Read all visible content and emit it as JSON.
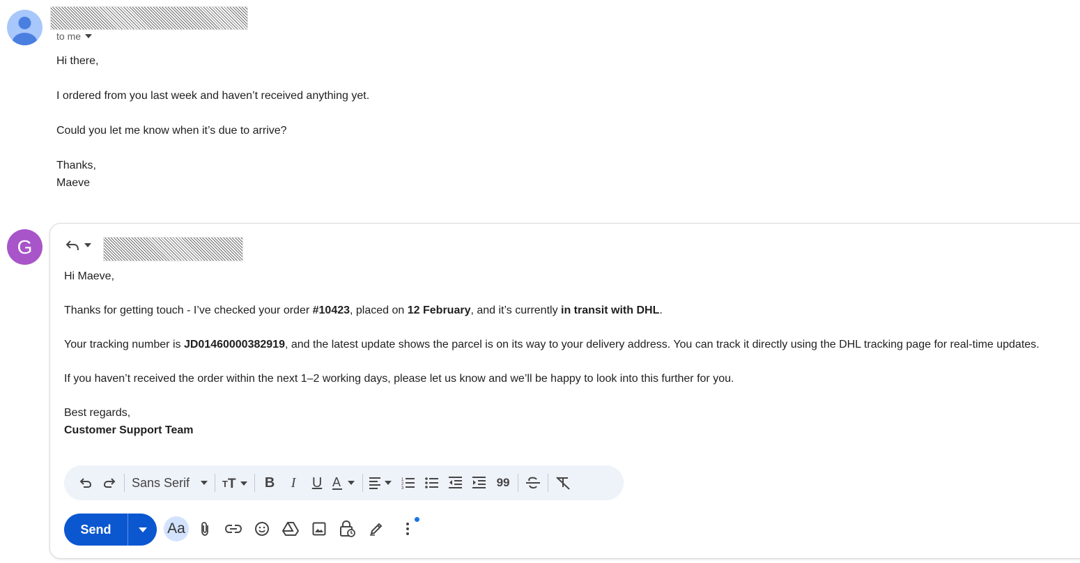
{
  "incoming": {
    "to_label": "to me",
    "body": "Hi there,\n\nI ordered from you last week and haven’t received anything yet.\n\nCould you let me know when it’s due to arrive?\n\nThanks,\nMaeve"
  },
  "reply": {
    "avatar_letter": "G",
    "greeting": "Hi Maeve,",
    "p1": {
      "a": "Thanks for getting touch - I’ve checked your order ",
      "order": "#10423",
      "b": ", placed on ",
      "date": "12 February",
      "c": ", and it’s currently ",
      "status": "in transit with DHL",
      "d": "."
    },
    "p2": {
      "a": "Your tracking number is ",
      "tracking": "JD01460000382919",
      "b": ", and the latest update shows the parcel is on its way to your delivery address. You can track it directly using the DHL tracking page for real-time updates."
    },
    "p3": "If you haven’t received the order within the next 1–2 working days, please let us know and we’ll be happy to look into this further for you.",
    "closing": "Best regards,",
    "signature": "Customer Support Team"
  },
  "toolbar": {
    "font": "Sans Serif",
    "buttons": [
      "undo-icon",
      "redo-icon",
      "text-size-icon",
      "bold-icon",
      "italic-icon",
      "underline-icon",
      "text-color-icon",
      "align-icon",
      "numbered-list-icon",
      "bulleted-list-icon",
      "indent-less-icon",
      "indent-more-icon",
      "quote-icon",
      "strikethrough-icon",
      "remove-formatting-icon"
    ]
  },
  "actions": {
    "send_label": "Send",
    "format_label": "Aa",
    "tools": [
      "attach-icon",
      "link-icon",
      "emoji-icon",
      "drive-icon",
      "photo-icon",
      "confidential-icon",
      "signature-icon",
      "more-options-icon"
    ]
  },
  "colors": {
    "send": "#0b57d0",
    "format_bar": "#eef2f9",
    "avatar_g": "#a855c9",
    "avatar_person": "#a8c7fa"
  }
}
